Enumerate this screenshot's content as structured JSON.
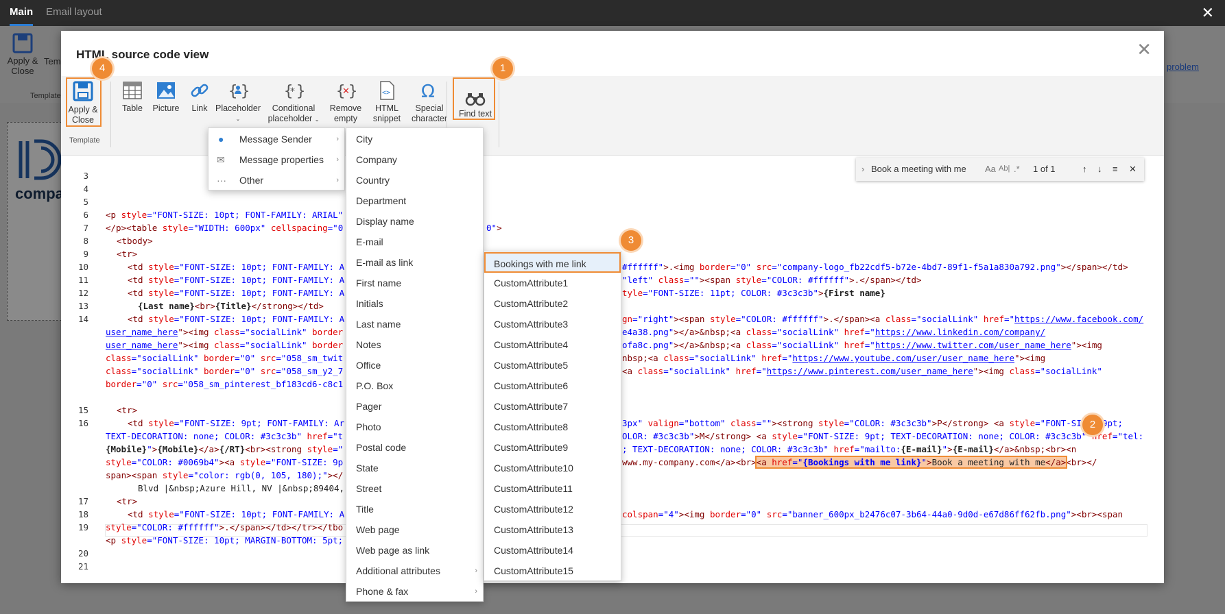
{
  "app": {
    "tabs": [
      "Main",
      "Email layout"
    ],
    "apply_close": "Apply &\nClose",
    "template_label": "Temp",
    "group_label": "Template",
    "logo_text": "compa",
    "link_text": "problem"
  },
  "dialog": {
    "title": "HTML source code view",
    "ribbon": {
      "apply_close_l1": "Apply &",
      "apply_close_l2": "Close",
      "group_label": "Template",
      "table": "Table",
      "picture": "Picture",
      "link": "Link",
      "placeholder": "Placeholder",
      "conditional_l1": "Conditional",
      "conditional_l2": "placeholder",
      "remove_l1": "Remove",
      "remove_l2": "empty",
      "snippet_l1": "HTML",
      "snippet_l2": "snippet",
      "special_l1": "Special",
      "special_l2": "character",
      "find_text": "Find text"
    },
    "badges": [
      "1",
      "2",
      "3",
      "4"
    ],
    "find": {
      "query": "Book a meeting with me",
      "match_case": "Aa",
      "whole_word": "Ab|",
      "regex": ".*",
      "count": "1 of 1"
    }
  },
  "code": {
    "line_numbers": [
      "3",
      "4",
      "5",
      "6",
      "7",
      "8",
      "9",
      "10",
      "11",
      "12",
      "13",
      "14",
      "15",
      "16",
      "17",
      "18",
      "19",
      "20",
      "21"
    ],
    "l6": {
      "t1": "<p ",
      "a1": "style",
      "eq": "=",
      "v1": "\"FONT-SIZE: 10pt; FONT-FAMILY: ARIAL\""
    },
    "l7": {
      "t1": "</p><table ",
      "a1": "style",
      "v1": "=\"WIDTH: 600px\"",
      "a2": " cellspacing",
      "v2": "=\"0",
      "v3": "0\"",
      "t2": ">"
    },
    "l8": "<tbody>",
    "l9": "<tr>",
    "l10": {
      "t1": "<td ",
      "a1": "style",
      "v1": "=\"FONT-SIZE: 10pt; FONT-FAMILY: A",
      "v2": "#ffffff\"",
      "t2": ">.<img ",
      "a2": "border",
      "v3": "=\"0\"",
      "a3": " src",
      "v4": "=\"company-logo_fb22cdf5-b72e-4bd7-89f1-f5a1a830a792.png\"",
      "t3": "></span></td>"
    },
    "l11": {
      "t1": "<td ",
      "a1": "style",
      "v1": "=\"FONT-SIZE: 10pt; FONT-FAMILY: A",
      "v2": "\"left\"",
      "a2": " class",
      "v3": "=\"\"",
      "t2": "><span ",
      "a3": "style",
      "v4": "=\"COLOR: #ffffff\"",
      "t3": ">.</span></td>"
    },
    "l12": {
      "t1": "<td ",
      "a1": "style",
      "v1": "=\"FONT-SIZE: 10pt; FONT-FAMILY: A",
      "a2": "tyle",
      "v2": "=\"FONT-SIZE: 11pt; COLOR: #3c3c3b\"",
      "t2": ">",
      "b1": "{First name}"
    },
    "l13": {
      "b1": "{Last name}",
      "t1": "<br>",
      "b2": "{Title}",
      "t2": "</strong></td>"
    },
    "l14a": {
      "t1": "<td ",
      "a1": "style",
      "v1": "=\"FONT-SIZE: 10pt; FONT-FAMILY: A",
      "a2": "gn",
      "v2": "=\"right\"",
      "t2": "><span ",
      "a3": "style",
      "v3": "=\"COLOR: #ffffff\"",
      "t3": ">.</span><a ",
      "a4": "class",
      "v4": "=\"socialLink\"",
      "a5": " href",
      "u1": "https://www.facebook.com/"
    },
    "l14b": {
      "u1": "user_name_here",
      "t1": "\"><img ",
      "a1": "class",
      "v1": "=\"socialLink\"",
      "a2": " border",
      "v2": "e4a38.png\"",
      "t2": "></a>&nbsp;<a ",
      "a3": "class",
      "v3": "=\"socialLink\"",
      "a4": " href",
      "u2": "https://www.linkedin.com/company/"
    },
    "l14c": {
      "u1": "user_name_here",
      "t1": "\"><img ",
      "a1": "class",
      "v1": "=\"socialLink\"",
      "a2": " border",
      "v2": "ofa8c.png\"",
      "t2": "></a>&nbsp;<a ",
      "a3": "class",
      "v3": "=\"socialLink\"",
      "a4": " href",
      "u2": "https://www.twitter.com/user_name_here",
      "t3": "\"><img"
    },
    "l14d": {
      "a1": "class",
      "v1": "=\"socialLink\"",
      "a2": " border",
      "v2": "=\"0\"",
      "a3": " src",
      "v3": "=\"058_sm_twit",
      "t1": "nbsp;<a ",
      "a4": "class",
      "v4": "=\"socialLink\"",
      "a5": " href",
      "u1": "https://www.youtube.com/user/user_name_here",
      "t2": "\"><img"
    },
    "l14e": {
      "a1": "class",
      "v1": "=\"socialLink\"",
      "a2": " border",
      "v2": "=\"0\"",
      "a3": " src",
      "v3": "=\"058_sm_y2_7",
      "t1": "<a ",
      "a4": "class",
      "v4": "=\"socialLink\"",
      "a5": " href",
      "u1": "https://www.pinterest.com/user_name_here",
      "t2": "\"><img ",
      "a6": "class",
      "v5": "=\"socialLink\""
    },
    "l14f": {
      "a1": "border",
      "v1": "=\"0\"",
      "a2": " src",
      "v2": "=\"058_sm_pinterest_bf183cd6-c8c1"
    },
    "l15": "<tr>",
    "l16a": {
      "t1": "<td ",
      "a1": "style",
      "v1": "=\"FONT-SIZE: 9pt; FONT-FAMILY: Ar",
      "v2": "3px\"",
      "a2": " valign",
      "v3": "=\"bottom\"",
      "a3": " class",
      "v4": "=\"\"",
      "t2": "><strong ",
      "a4": "style",
      "v5": "=\"COLOR: #3c3c3b\"",
      "t3": ">P</strong> <a ",
      "a5": "style",
      "v6": "=\"FONT-SIZE: 9pt;"
    },
    "l16b": {
      "v1": "TEXT-DECORATION: none; COLOR: #3c3c3b\"",
      "a1": " href",
      "v2": "=\"t",
      "v3": "OLOR: #3c3c3b\"",
      "t1": ">M</strong> <a ",
      "a2": "style",
      "v4": "=\"FONT-SIZE: 9pt; TEXT-DECORATION: none; COLOR: #3c3c3b\"",
      "a3": " href",
      "v5": "=\"tel:"
    },
    "l16c": {
      "b1": "{Mobile}",
      "v1": "\"",
      "t1": ">",
      "b2": "{Mobile}",
      "t2": "</a>",
      "b3": "{/RT}",
      "t3": "<br><strong ",
      "a1": "style",
      "v2": "=\"",
      "v3": "; TEXT-DECORATION: none; COLOR: #3c3c3b\"",
      "a2": " href",
      "v4": "=\"mailto:",
      "b4": "{E-mail}",
      "v5": "\"",
      "t4": ">",
      "b5": "{E-mail}",
      "t5": "</a>&nbsp;<br><",
      "t6": "n"
    },
    "l16d": {
      "a1": "style",
      "v1": "=\"COLOR: #0069b4\"",
      "t1": "><a ",
      "a2": "style",
      "v2": "=\"FONT-SIZE: 9p",
      "t2": "www.my-company.com</a><br>",
      "hl_t": "<a ",
      "hl_a": "href",
      "hl_v1": "=\"",
      "hl_b": "{Bookings with me link}",
      "hl_v2": "\"",
      "hl_t2": ">",
      "hl_text": "Book a meeting with me",
      "hl_t3": "</a>",
      "t3": "<br></"
    },
    "l16e": {
      "t1": "span><span ",
      "a1": "style",
      "v1": "=\"color: rgb(0, 105, 180);\"",
      "t2": "></"
    },
    "l17": "Blvd |&nbsp;Azure Hill, NV |&nbsp;89404,",
    "l18": "<tr>",
    "l19a": {
      "t1": "<td ",
      "a1": "style",
      "v1": "=\"FONT-SIZE: 10pt; FONT-FAMILY: A",
      "a2": "colspan",
      "v2": "=\"4\"",
      "t2": "><img ",
      "a3": "border",
      "v3": "=\"0\"",
      "a4": " src",
      "v4": "=\"banner_600px_b2476c07-3b64-44a0-9d0d-e67d86ff62fb.png\"",
      "t3": "><br><span"
    },
    "l19b": {
      "a1": "style",
      "v1": "=\"COLOR: #ffffff\"",
      "t1": ">.</span></td></tr></tbo"
    },
    "l20": {
      "t1": "<p ",
      "a1": "style",
      "v1": "=\"FONT-SIZE: 10pt; MARGIN-BOTTOM: 5pt;"
    }
  },
  "menus": {
    "main": [
      {
        "label": "Message Sender",
        "icon": "person-icon"
      },
      {
        "label": "Message properties",
        "icon": "envelope-icon"
      },
      {
        "label": "Other",
        "icon": "more-icon"
      }
    ],
    "fields": [
      "City",
      "Company",
      "Country",
      "Department",
      "Display name",
      "E-mail",
      "E-mail as link",
      "First name",
      "Initials",
      "Last name",
      "Notes",
      "Office",
      "P.O. Box",
      "Pager",
      "Photo",
      "Postal code",
      "State",
      "Street",
      "Title",
      "Web page",
      "Web page as link",
      "Additional attributes",
      "Phone & fax"
    ],
    "attributes": [
      "Bookings with me link",
      "CustomAttribute1",
      "CustomAttribute2",
      "CustomAttribute3",
      "CustomAttribute4",
      "CustomAttribute5",
      "CustomAttribute6",
      "CustomAttribute7",
      "CustomAttribute8",
      "CustomAttribute9",
      "CustomAttribute10",
      "CustomAttribute11",
      "CustomAttribute12",
      "CustomAttribute13",
      "CustomAttribute14",
      "CustomAttribute15"
    ]
  },
  "colors": {
    "accent": "#ef8b34",
    "tag": "#800000",
    "attr": "#e00000",
    "value": "#0000ff"
  }
}
